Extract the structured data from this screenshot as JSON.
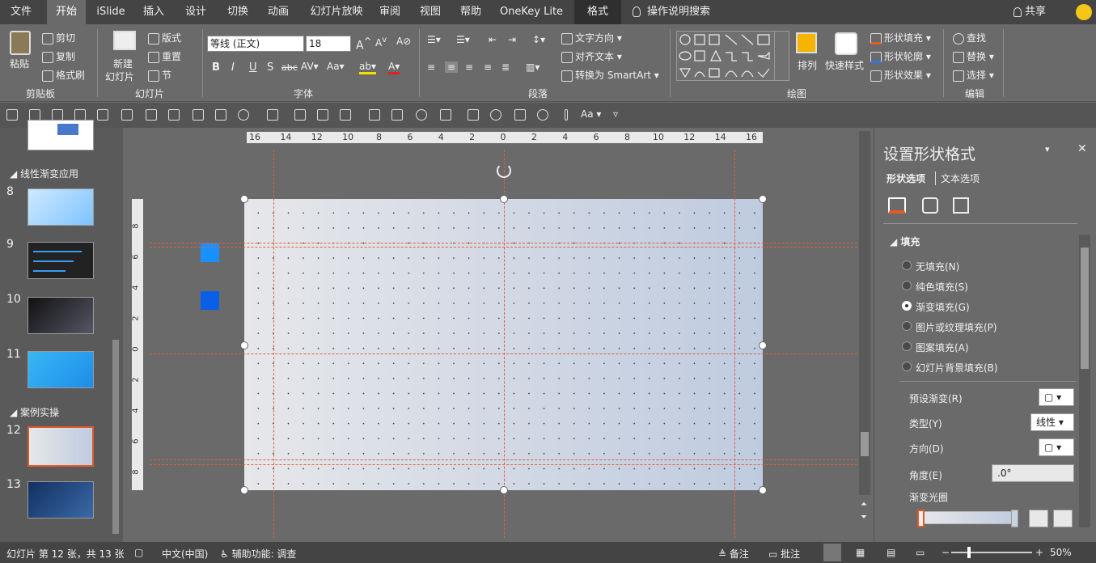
{
  "menu": {
    "tabs": [
      "文件",
      "开始",
      "iSlide",
      "插入",
      "设计",
      "切换",
      "动画",
      "幻灯片放映",
      "审阅",
      "视图",
      "帮助",
      "OneKey Lite",
      "格式"
    ],
    "search": "操作说明搜索",
    "share": "共享"
  },
  "ribbon": {
    "clipboard": {
      "paste": "粘贴",
      "cut": "剪切",
      "copy": "复制",
      "format_painter": "格式刷",
      "label": "剪贴板"
    },
    "slides": {
      "new_slide": "新建",
      "new_slide2": "幻灯片",
      "layout": "版式",
      "reset": "重置",
      "section": "节",
      "label": "幻灯片"
    },
    "font": {
      "name": "等线 (正文)",
      "size": "18",
      "label": "字体"
    },
    "paragraph": {
      "text_direction": "文字方向",
      "align_text": "对齐文本",
      "smartart": "转换为 SmartArt",
      "label": "段落"
    },
    "drawing": {
      "arrange": "排列",
      "quick_styles": "快速样式",
      "fill": "形状填充",
      "outline": "形状轮廓",
      "effects": "形状效果",
      "label": "绘图"
    },
    "editing": {
      "find": "查找",
      "replace": "替换",
      "select": "选择",
      "label": "编辑"
    }
  },
  "thumbnails": {
    "sections": [
      "线性渐变应用",
      "案例实操"
    ],
    "slides": [
      {
        "num": "8"
      },
      {
        "num": "9"
      },
      {
        "num": "10"
      },
      {
        "num": "11"
      },
      {
        "num": "12"
      },
      {
        "num": "13"
      }
    ]
  },
  "ruler_top_ticks": [
    "16",
    "14",
    "12",
    "10",
    "8",
    "6",
    "4",
    "2",
    "0",
    "2",
    "4",
    "6",
    "8",
    "10",
    "12",
    "14",
    "16"
  ],
  "ruler_left_ticks": [
    "8",
    "6",
    "4",
    "2",
    "0",
    "2",
    "4",
    "6",
    "8"
  ],
  "colors": {
    "accent": "#e05a2b",
    "swatch1": "#1a90ff",
    "swatch2": "#0a5fe8"
  },
  "panel": {
    "title": "设置形状格式",
    "tab_shape": "形状选项",
    "tab_text": "文本选项",
    "section_fill": "填充",
    "options": [
      "无填充(N)",
      "纯色填充(S)",
      "渐变填充(G)",
      "图片或纹理填充(P)",
      "图案填充(A)",
      "幻灯片背景填充(B)"
    ],
    "selected_index": 2,
    "preset": "预设渐变(R)",
    "type_label": "类型(Y)",
    "type_value": "线性",
    "direction": "方向(D)",
    "angle_label": "角度(E)",
    "angle_value": ".0°",
    "stops": "渐变光圈"
  },
  "status": {
    "slide_info": "幻灯片 第 12 张，共 13 张",
    "language": "中文(中国)",
    "accessibility": "辅助功能: 调查",
    "notes": "备注",
    "comments": "批注",
    "zoom": "50%"
  }
}
